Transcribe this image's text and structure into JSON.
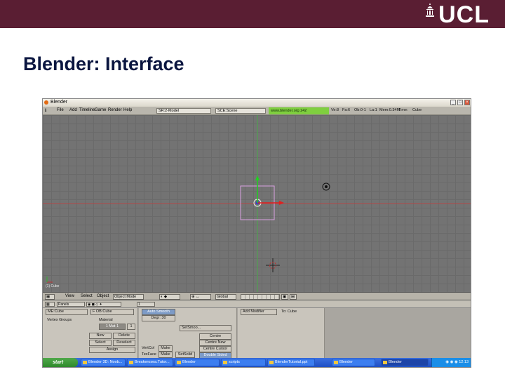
{
  "brand": {
    "logo_text": "UCL",
    "banner_color": "#5a1e33"
  },
  "slide": {
    "title": "Blender: Interface"
  },
  "window": {
    "title": "Blender"
  },
  "menubar": {
    "items": [
      "File",
      "Add",
      "Timeline",
      "Game",
      "Render",
      "Help"
    ],
    "screen_field": "SR:2-Model",
    "scene_field": "SCE:Scene",
    "status": "www.blender.org 242",
    "stats": [
      "Ve:8",
      "Fa:6",
      "Ob:0-1",
      "La:1",
      "Mem:0.34M",
      "Time:",
      "Cube"
    ]
  },
  "viewport": {
    "object_label": "(1) Cube",
    "colors": {
      "background": "#737373",
      "x_axis": "#c03030",
      "y_axis": "#30b030",
      "selection": "#d8a0e0"
    }
  },
  "view_header": {
    "items": [
      "View",
      "Select",
      "Object"
    ],
    "mode": "Object Mode",
    "pivot": "Global"
  },
  "buttons_header": {
    "panels_label": "Panels",
    "frame": "1"
  },
  "link_panel": {
    "mesh_field": "ME:Cube",
    "object_field": "F OB:Cube",
    "vertex_groups_label": "Vertex Groups",
    "material_label": "Material",
    "material_field": "1 Mat 1",
    "material_count": "1",
    "buttons": [
      "New",
      "Delete",
      "Select",
      "Deselect",
      "Assign"
    ]
  },
  "mesh_panel": {
    "auto_smooth": "Auto Smooth",
    "degr": "Degr: 30",
    "set_smooth": "SetSmoo...",
    "centre": "Centre",
    "centre_new": "Centre New",
    "centre_cursor": "Centre Cursor",
    "vert_label": "VertCol",
    "tex_label": "TexFace",
    "make_label": "Make",
    "set_solid": "SetSolid",
    "double_sided": "Double Sided"
  },
  "modifiers_panel": {
    "add_modifier": "Add Modifier",
    "to_label": "To: Cube"
  },
  "taskbar": {
    "start_label": "start",
    "tasks": [
      "Blender 3D: Noob...",
      "Breakerosea.Tutor...",
      "Blender",
      "scripts",
      "BlenderTutorial.ppt",
      "Blender",
      "Blender"
    ],
    "clock": "12:13"
  }
}
